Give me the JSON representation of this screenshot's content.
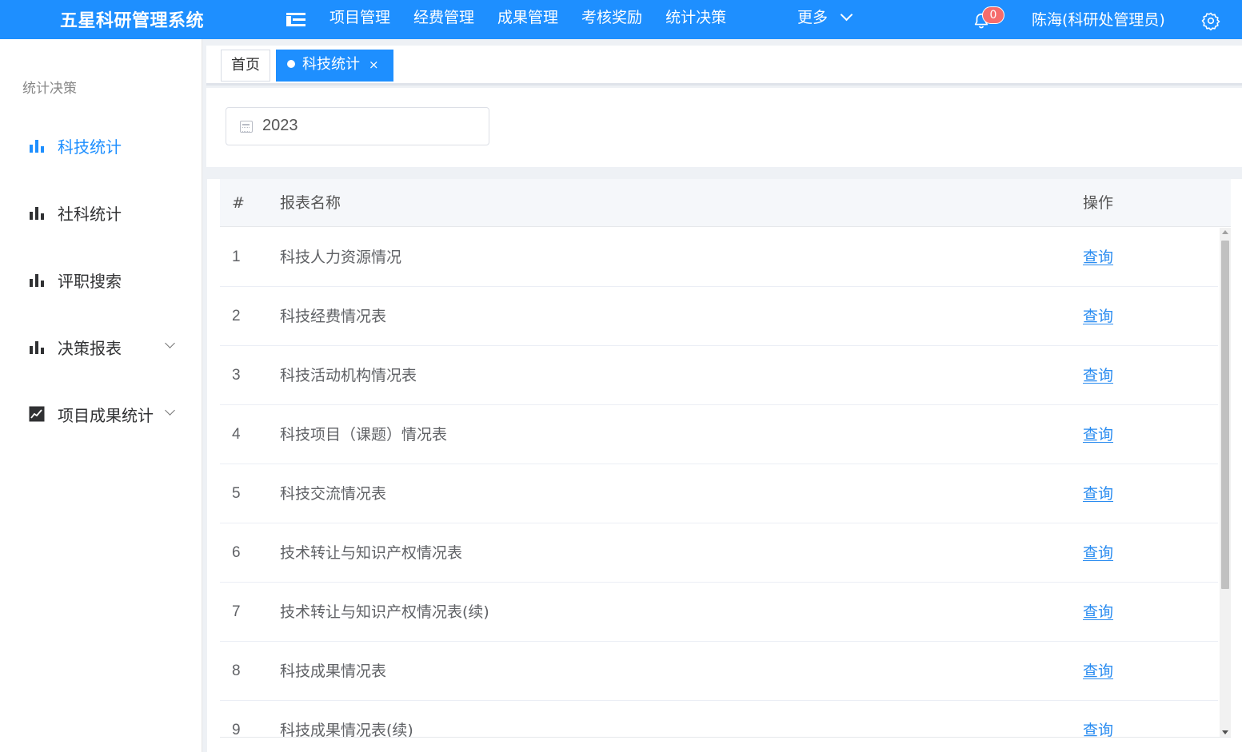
{
  "header": {
    "app_title": "五星科研管理系统",
    "nav": [
      "项目管理",
      "经费管理",
      "成果管理",
      "考核奖励",
      "统计决策"
    ],
    "more_label": "更多",
    "notification_count": "0",
    "user_name": "陈海(科研处管理员)",
    "accent_color": "#1e8fff"
  },
  "sidebar": {
    "group_title": "统计决策",
    "items": [
      {
        "label": "科技统计",
        "icon": "bar-chart-icon",
        "active": true
      },
      {
        "label": "社科统计",
        "icon": "bar-chart-icon"
      },
      {
        "label": "评职搜索",
        "icon": "bar-chart-icon"
      },
      {
        "label": "决策报表",
        "icon": "bar-chart-icon",
        "expandable": true
      },
      {
        "label": "项目成果统计",
        "icon": "line-chart-icon",
        "expandable": true
      }
    ]
  },
  "tabs": {
    "home": "首页",
    "active": "科技统计",
    "close": "×"
  },
  "filter": {
    "year": "2023"
  },
  "table": {
    "headers": {
      "index": "#",
      "name": "报表名称",
      "action": "操作"
    },
    "rows": [
      {
        "index": "1",
        "name": "科技人力资源情况",
        "action": "查询"
      },
      {
        "index": "2",
        "name": "科技经费情况表",
        "action": "查询"
      },
      {
        "index": "3",
        "name": "科技活动机构情况表",
        "action": "查询"
      },
      {
        "index": "4",
        "name": "科技项目（课题）情况表",
        "action": "查询"
      },
      {
        "index": "5",
        "name": "科技交流情况表",
        "action": "查询"
      },
      {
        "index": "6",
        "name": "技术转让与知识产权情况表",
        "action": "查询"
      },
      {
        "index": "7",
        "name": "技术转让与知识产权情况表(续)",
        "action": "查询"
      },
      {
        "index": "8",
        "name": "科技成果情况表",
        "action": "查询"
      },
      {
        "index": "9",
        "name": "科技成果情况表(续)",
        "action": "查询"
      }
    ]
  }
}
